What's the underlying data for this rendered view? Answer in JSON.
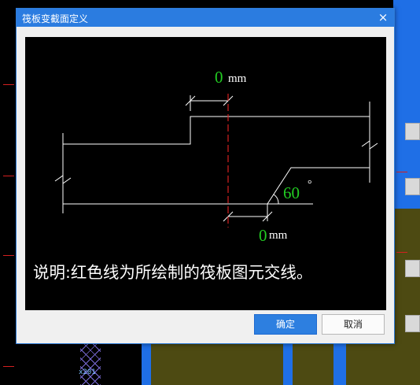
{
  "dialog": {
    "title": "筏板变截面定义",
    "close_glyph": "×",
    "ok_label": "确定",
    "cancel_label": "取消"
  },
  "diagram": {
    "top_dimension_value": "0",
    "top_dimension_unit": "mm",
    "bottom_dimension_value": "0",
    "bottom_dimension_unit": "mm",
    "angle_value": "60",
    "angle_unit": "°",
    "note": "说明:红色线为所绘制的筏板图元交线。",
    "colors": {
      "line": "#ffffff",
      "boundary": "#d42020",
      "value": "#22cc22",
      "background": "#000000"
    }
  },
  "background": {
    "axis_label": "x201"
  }
}
